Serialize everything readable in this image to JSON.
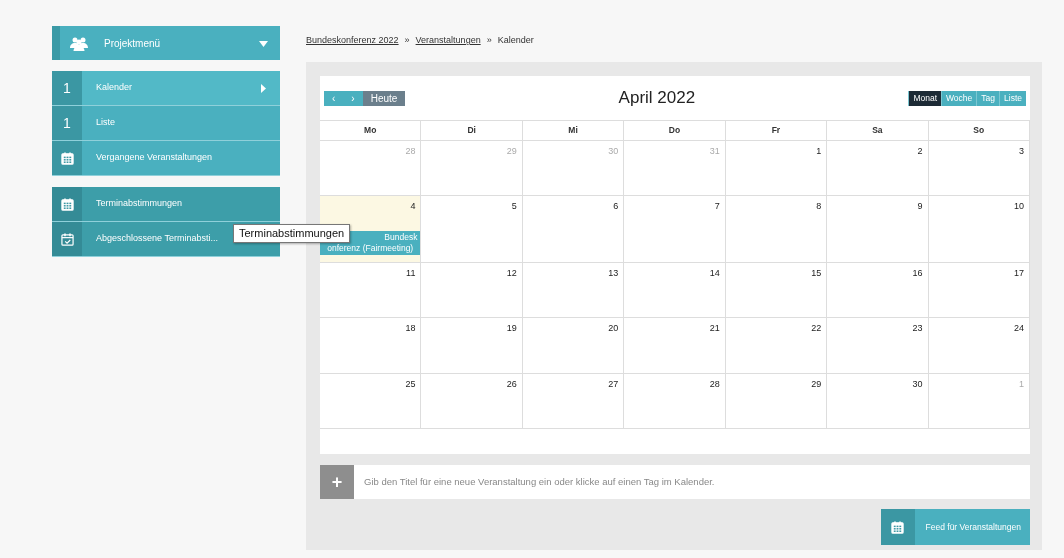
{
  "sidebar": {
    "header": {
      "label": "Projektmenü",
      "expanded": true
    },
    "groups": [
      [
        {
          "kind": "count",
          "badge": "1",
          "label": "Kalender",
          "selected": true
        },
        {
          "kind": "count",
          "badge": "1",
          "label": "Liste",
          "selected": false
        },
        {
          "kind": "calendar",
          "label": "Vergangene Veranstaltungen",
          "selected": false
        }
      ],
      [
        {
          "kind": "calendar",
          "label": "Terminabstimmungen",
          "selected": false
        },
        {
          "kind": "calendar-check",
          "label": "Abgeschlossene Terminabsti...",
          "selected": false
        }
      ]
    ]
  },
  "tooltip": "Terminabstimmungen",
  "breadcrumb": [
    {
      "label": "Bundeskonferenz 2022",
      "link": true
    },
    {
      "label": "»",
      "link": false
    },
    {
      "label": "Veranstaltungen",
      "link": true
    },
    {
      "label": "»",
      "link": false
    },
    {
      "label": "Kalender",
      "link": false
    }
  ],
  "calendar": {
    "prev": "‹",
    "next": "›",
    "today_button": "Heute",
    "title": "April 2022",
    "views": [
      {
        "label": "Monat",
        "selected": true
      },
      {
        "label": "Woche",
        "selected": false
      },
      {
        "label": "Tag",
        "selected": false
      },
      {
        "label": "Liste",
        "selected": false
      }
    ],
    "weekdays": [
      "Mo",
      "Di",
      "Mi",
      "Do",
      "Fr",
      "Sa",
      "So"
    ],
    "weeks": [
      [
        {
          "day": "28",
          "other_month": true
        },
        {
          "day": "29",
          "other_month": true
        },
        {
          "day": "30",
          "other_month": true
        },
        {
          "day": "31",
          "other_month": true
        },
        {
          "day": "1",
          "other_month": false
        },
        {
          "day": "2",
          "other_month": false
        },
        {
          "day": "3",
          "other_month": false
        }
      ],
      [
        {
          "day": "4",
          "other_month": false,
          "today": true,
          "events": [
            {
              "lines": [
                "Bundesk",
                "onferenz (Fairmeeting)"
              ]
            }
          ]
        },
        {
          "day": "5",
          "other_month": false
        },
        {
          "day": "6",
          "other_month": false
        },
        {
          "day": "7",
          "other_month": false
        },
        {
          "day": "8",
          "other_month": false
        },
        {
          "day": "9",
          "other_month": false
        },
        {
          "day": "10",
          "other_month": false
        }
      ],
      [
        {
          "day": "11",
          "other_month": false
        },
        {
          "day": "12",
          "other_month": false
        },
        {
          "day": "13",
          "other_month": false
        },
        {
          "day": "14",
          "other_month": false
        },
        {
          "day": "15",
          "other_month": false
        },
        {
          "day": "16",
          "other_month": false
        },
        {
          "day": "17",
          "other_month": false
        }
      ],
      [
        {
          "day": "18",
          "other_month": false
        },
        {
          "day": "19",
          "other_month": false
        },
        {
          "day": "20",
          "other_month": false
        },
        {
          "day": "21",
          "other_month": false
        },
        {
          "day": "22",
          "other_month": false
        },
        {
          "day": "23",
          "other_month": false
        },
        {
          "day": "24",
          "other_month": false
        }
      ],
      [
        {
          "day": "25",
          "other_month": false
        },
        {
          "day": "26",
          "other_month": false
        },
        {
          "day": "27",
          "other_month": false
        },
        {
          "day": "28",
          "other_month": false
        },
        {
          "day": "29",
          "other_month": false
        },
        {
          "day": "30",
          "other_month": false
        },
        {
          "day": "1",
          "other_month": true
        }
      ]
    ]
  },
  "new_event": {
    "add": "+",
    "placeholder": "Gib den Titel für eine neue Veranstaltung ein oder klicke auf einen Tag im Kalender."
  },
  "feed_button": "Feed für Veranstaltungen"
}
